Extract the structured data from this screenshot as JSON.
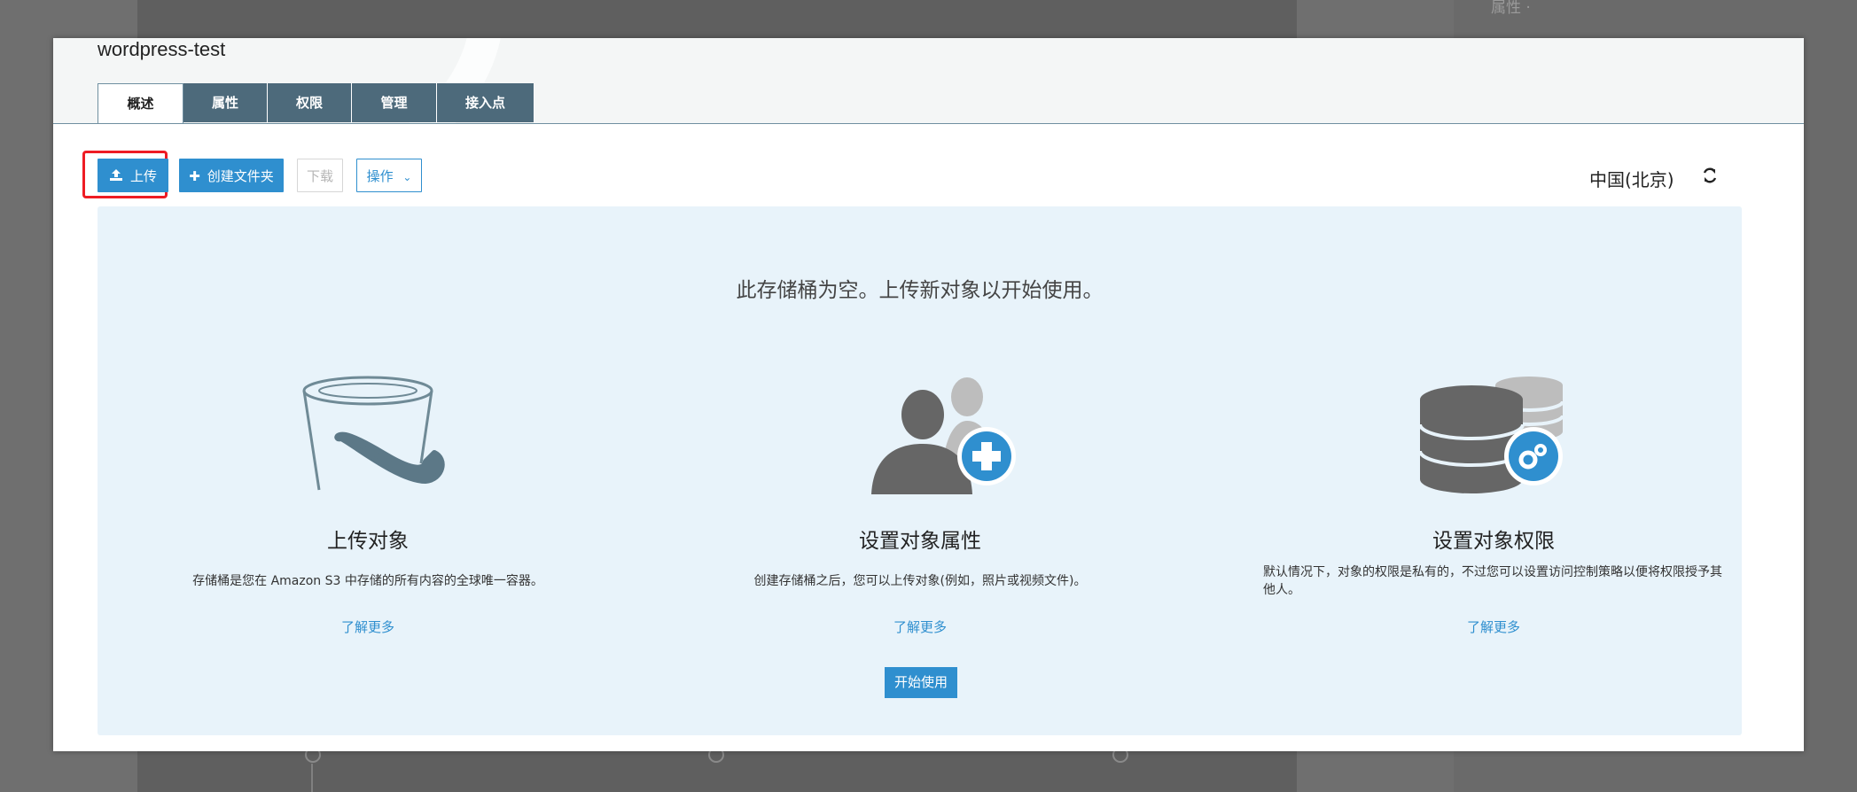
{
  "background": {
    "right_panel_text": "属性 ·"
  },
  "modal": {
    "bucket_title": "wordpress-test",
    "tabs": [
      {
        "label": "概述",
        "active": true
      },
      {
        "label": "属性",
        "active": false
      },
      {
        "label": "权限",
        "active": false
      },
      {
        "label": "管理",
        "active": false
      },
      {
        "label": "接入点",
        "active": false
      }
    ],
    "toolbar": {
      "upload_label": "上传",
      "upload_icon": "upload-icon",
      "create_folder_label": "创建文件夹",
      "create_folder_icon": "plus-icon",
      "download_label": "下载",
      "actions_label": "操作",
      "actions_icon": "chevron-down-icon"
    },
    "region": "中国(北京)",
    "refresh_icon": "refresh-icon",
    "empty_message": "此存储桶为空。上传新对象以开始使用。",
    "columns": [
      {
        "icon": "bucket-icon",
        "title": "上传对象",
        "description": "存储桶是您在 Amazon S3 中存储的所有内容的全球唯一容器。",
        "link": "了解更多"
      },
      {
        "icon": "users-add-icon",
        "title": "设置对象属性",
        "description": "创建存储桶之后，您可以上传对象(例如，照片或视频文件)。",
        "link": "了解更多"
      },
      {
        "icon": "database-gear-icon",
        "title": "设置对象权限",
        "description": "默认情况下，对象的权限是私有的，不过您可以设置访问控制策略以便将权限授予其他人。",
        "link": "了解更多"
      }
    ],
    "start_button": "开始使用"
  },
  "colors": {
    "accent": "#2f8fcf",
    "tab_bg": "#4d6a7b",
    "panel_bg": "#e8f3fa",
    "highlight": "#ee1c24"
  }
}
